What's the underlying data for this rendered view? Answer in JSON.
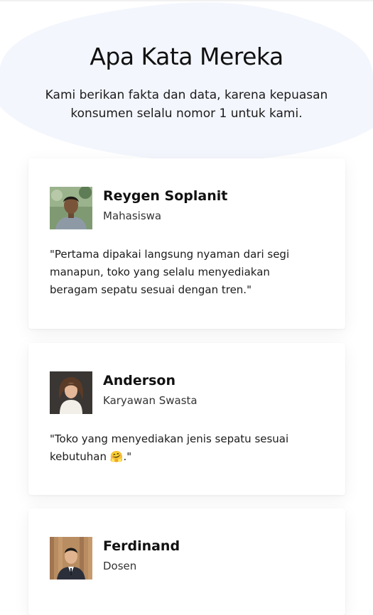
{
  "section": {
    "title": "Apa Kata Mereka",
    "subtitle": "Kami berikan fakta dan data, karena kepuasan konsumen selalu nomor 1 untuk kami."
  },
  "testimonials": [
    {
      "name": "Reygen Soplanit",
      "role": "Mahasiswa",
      "quote": "\"Pertama dipakai langsung nyaman dari segi manapun, toko yang selalu menyediakan beragam sepatu sesuai dengan tren.\""
    },
    {
      "name": "Anderson",
      "role": "Karyawan Swasta",
      "quote": "\"Toko yang menyediakan jenis sepatu sesuai kebutuhan 🤗.\""
    },
    {
      "name": "Ferdinand",
      "role": "Dosen",
      "quote": ""
    }
  ],
  "colors": {
    "background_blob": "#f3f6fd",
    "card": "#ffffff",
    "text": "#111111"
  }
}
